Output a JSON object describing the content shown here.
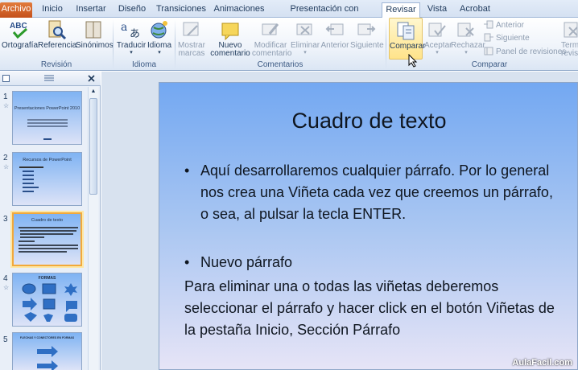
{
  "tabs": [
    {
      "label": "Archivo"
    },
    {
      "label": "Inicio"
    },
    {
      "label": "Insertar"
    },
    {
      "label": "Diseño"
    },
    {
      "label": "Transiciones"
    },
    {
      "label": "Animaciones"
    },
    {
      "label": "Presentación con diapositivas"
    },
    {
      "label": "Revisar"
    },
    {
      "label": "Vista"
    },
    {
      "label": "Acrobat"
    }
  ],
  "ribbon": {
    "revision": {
      "label": "Revisión",
      "ortografia": "Ortografía",
      "referencia": "Referencia",
      "sinonimos": "Sinónimos"
    },
    "idioma": {
      "label": "Idioma",
      "traducir": "Traducir",
      "idioma": "Idioma"
    },
    "comentarios": {
      "label": "Comentarios",
      "mostrar_1": "Mostrar",
      "mostrar_2": "marcas",
      "nuevo_1": "Nuevo",
      "nuevo_2": "comentario",
      "modificar_1": "Modificar",
      "modificar_2": "comentario",
      "eliminar": "Eliminar",
      "anterior": "Anterior",
      "siguiente": "Siguiente"
    },
    "comparar": {
      "label": "Comparar",
      "comparar": "Comparar",
      "aceptar": "Aceptar",
      "rechazar": "Rechazar",
      "anterior": "Anterior",
      "siguiente": "Siguiente",
      "panel": "Panel de revisiones",
      "terminar_1": "Termi",
      "terminar_2": "revis"
    }
  },
  "thumbnails": [
    {
      "num": "1",
      "title": "Presentaciones PowerPoint 2010"
    },
    {
      "num": "2",
      "title": "Recursos de PowerPoint"
    },
    {
      "num": "3",
      "title": "Cuadro de texto"
    },
    {
      "num": "4",
      "title": "FORMAS"
    },
    {
      "num": "5",
      "title": "FLECHAS Y CONECTORES EN FORMAS"
    }
  ],
  "slide": {
    "title": "Cuadro de texto",
    "bullet_1": "Aquí desarrollaremos cualquier párrafo. Por lo general nos crea una Viñeta cada vez que creemos un párrafo, o sea, al pulsar la tecla ENTER.",
    "bullet_2": "Nuevo párrafo",
    "paragraph": "Para eliminar una o todas las viñetas deberemos seleccionar el párrafo y hacer click en el botón Viñetas de la pestaña Inicio, Sección Párrafo",
    "bullet_char": "•"
  },
  "watermark": "AulaFacil.com"
}
